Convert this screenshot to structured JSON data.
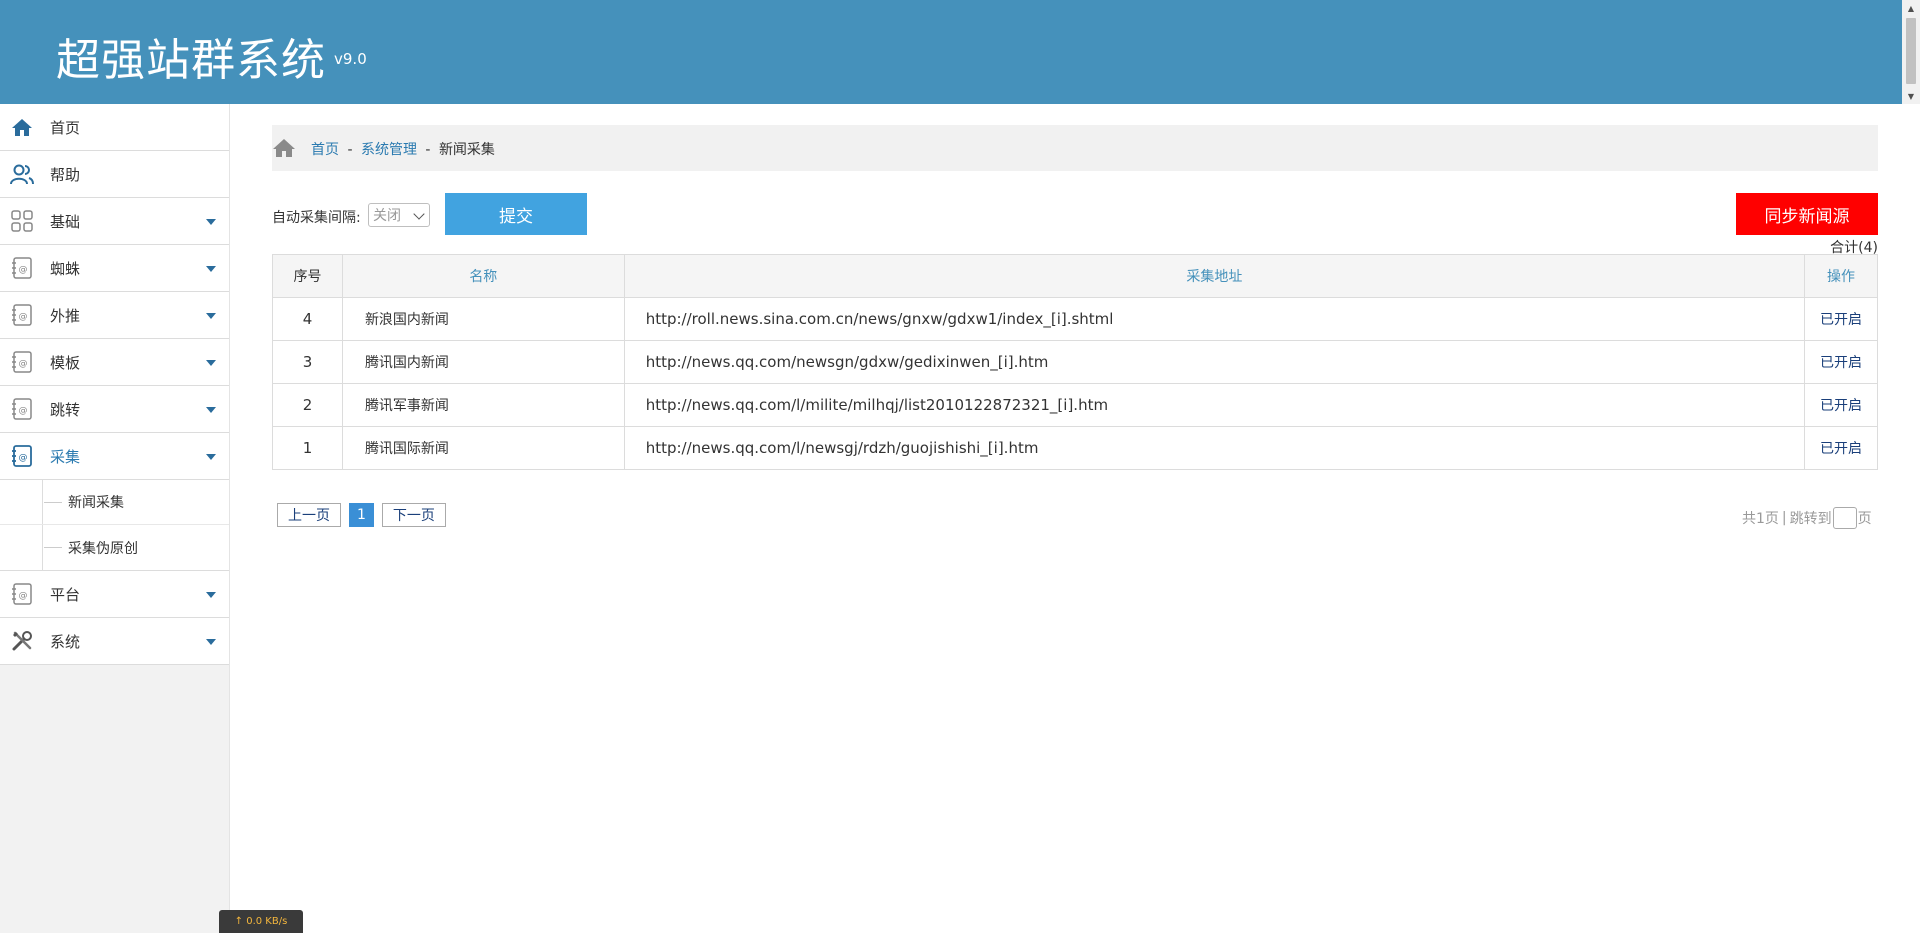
{
  "app": {
    "title": "超强站群系统",
    "version": "v9.0"
  },
  "sidebar": {
    "items": [
      {
        "label": "首页",
        "icon": "home-icon",
        "expandable": false
      },
      {
        "label": "帮助",
        "icon": "users-icon",
        "expandable": false
      },
      {
        "label": "基础",
        "icon": "grid-icon",
        "expandable": true
      },
      {
        "label": "蜘蛛",
        "icon": "notebook-icon",
        "expandable": true
      },
      {
        "label": "外推",
        "icon": "notebook-icon",
        "expandable": true
      },
      {
        "label": "模板",
        "icon": "notebook-icon",
        "expandable": true
      },
      {
        "label": "跳转",
        "icon": "notebook-icon",
        "expandable": true
      },
      {
        "label": "采集",
        "icon": "notebook-icon",
        "expandable": true,
        "active": true
      },
      {
        "label": "平台",
        "icon": "notebook-icon",
        "expandable": true
      },
      {
        "label": "系统",
        "icon": "tools-icon",
        "expandable": true
      }
    ],
    "submenu": [
      {
        "label": "新闻采集"
      },
      {
        "label": "采集伪原创"
      }
    ]
  },
  "breadcrumb": {
    "home": "首页",
    "sep1": "-",
    "section": "系统管理",
    "sep2": "-",
    "current": "新闻采集"
  },
  "toolbar": {
    "interval_label": "自动采集间隔:",
    "interval_value": "关闭",
    "submit_label": "提交",
    "sync_label": "同步新闻源",
    "total_label": "合计(4)"
  },
  "table": {
    "headers": {
      "no": "序号",
      "name": "名称",
      "url": "采集地址",
      "op": "操作"
    },
    "rows": [
      {
        "no": "4",
        "name": "新浪国内新闻",
        "url": "http://roll.news.sina.com.cn/news/gnxw/gdxw1/index_[i].shtml",
        "op": "已开启"
      },
      {
        "no": "3",
        "name": "腾讯国内新闻",
        "url": "http://news.qq.com/newsgn/gdxw/gedixinwen_[i].htm",
        "op": "已开启"
      },
      {
        "no": "2",
        "name": "腾讯军事新闻",
        "url": "http://news.qq.com/l/milite/milhqj/list2010122872321_[i].htm",
        "op": "已开启"
      },
      {
        "no": "1",
        "name": "腾讯国际新闻",
        "url": "http://news.qq.com/l/newsgj/rdzh/guojishishi_[i].htm",
        "op": "已开启"
      }
    ]
  },
  "pager": {
    "prev": "上一页",
    "current": "1",
    "next": "下一页",
    "total_pages": "共1页",
    "divider": "|",
    "jump_to": "跳转到",
    "page_suffix": "页"
  },
  "status": {
    "speed": "↑ 0.0 KB/s"
  },
  "colors": {
    "header": "#4591bb",
    "accent": "#41a3e0",
    "danger": "#ff0000",
    "link": "#2a7ab0"
  }
}
